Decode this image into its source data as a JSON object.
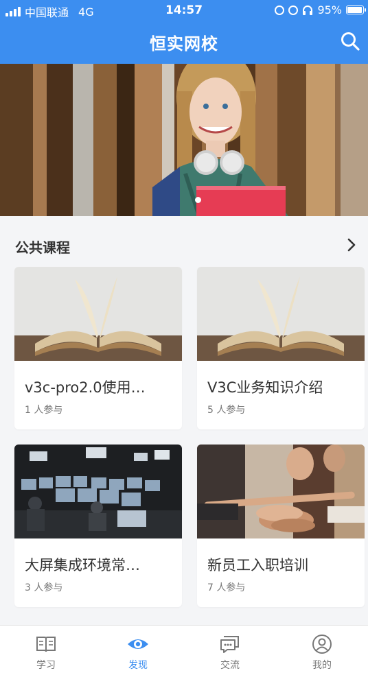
{
  "status_bar": {
    "carrier": "中国联通",
    "network": "4G",
    "time": "14:57",
    "battery": "95%"
  },
  "header": {
    "title": "恒实网校",
    "search_icon": "search-icon"
  },
  "banner": {
    "slide_index": 1,
    "slide_count": 1
  },
  "section": {
    "title": "公共课程"
  },
  "courses": [
    {
      "title": "v3c-pro2.0使用…",
      "participants": "1 人参与",
      "thumb": "open-book"
    },
    {
      "title": "V3C业务知识介绍",
      "participants": "5 人参与",
      "thumb": "open-book"
    },
    {
      "title": "大屏集成环境常…",
      "participants": "3 人参与",
      "thumb": "control-room"
    },
    {
      "title": "新员工入职培训",
      "participants": "7 人参与",
      "thumb": "team-hands"
    }
  ],
  "tabs": [
    {
      "label": "学习",
      "icon": "book-icon",
      "active": false
    },
    {
      "label": "发现",
      "icon": "eye-icon",
      "active": true
    },
    {
      "label": "交流",
      "icon": "chat-icon",
      "active": false
    },
    {
      "label": "我的",
      "icon": "user-icon",
      "active": false
    }
  ],
  "colors": {
    "brand": "#3c8ef0",
    "background": "#f4f5f7",
    "text": "#333333",
    "muted": "#777777"
  }
}
